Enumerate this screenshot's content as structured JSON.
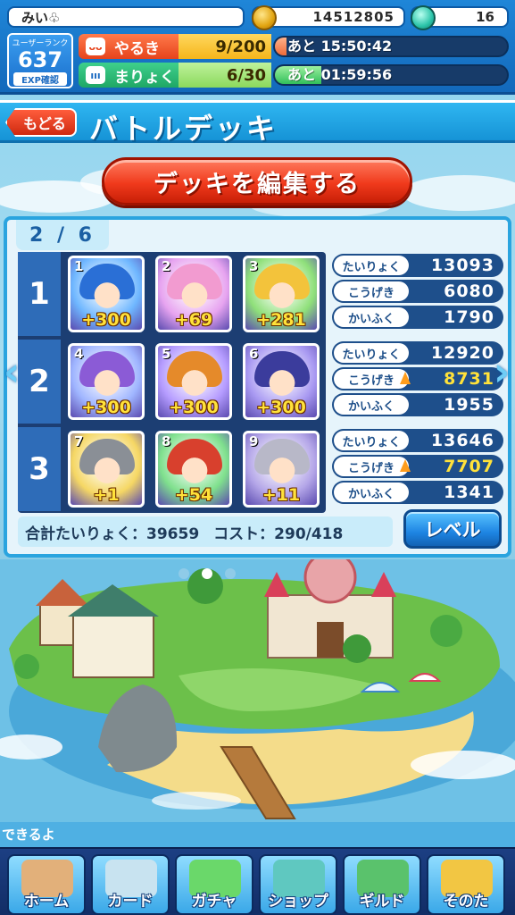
{
  "status": {
    "player_name": "みい♧",
    "coins": "14512805",
    "gems": "16",
    "rank_label": "ユーザーランク",
    "rank_value": "637",
    "exp_label": "EXP確認",
    "yaruki": {
      "label": "やるき",
      "count": "9/200",
      "timer": "あと 15:50:42",
      "fill": 0.05
    },
    "maryoku": {
      "label": "まりょく",
      "count": "6/30",
      "timer": "あと 01:59:56",
      "fill": 0.2
    }
  },
  "header": {
    "back_label": "もどる",
    "title": "バトルデッキ"
  },
  "edit_button_label": "デッキを編集する",
  "deck": {
    "page": "2 / 6",
    "rows": [
      {
        "num": "1",
        "cards": [
          {
            "slot": "1",
            "plus": "+300",
            "bg": "#6fb7ff",
            "hair": "#2a6fd6"
          },
          {
            "slot": "2",
            "plus": "+69",
            "bg": "#e7a4f0",
            "hair": "#f29bd0"
          },
          {
            "slot": "3",
            "plus": "+281",
            "bg": "#8fe07a",
            "hair": "#f3c33b"
          }
        ],
        "stats": [
          {
            "label": "たいりょく",
            "value": "13093",
            "boost": false
          },
          {
            "label": "こうげき",
            "value": "6080",
            "boost": false
          },
          {
            "label": "かいふく",
            "value": "1790",
            "boost": false
          }
        ]
      },
      {
        "num": "2",
        "cards": [
          {
            "slot": "4",
            "plus": "+300",
            "bg": "#9fb5ff",
            "hair": "#8b5bd6"
          },
          {
            "slot": "5",
            "plus": "+300",
            "bg": "#b59cff",
            "hair": "#e58a2a"
          },
          {
            "slot": "6",
            "plus": "+300",
            "bg": "#a99af2",
            "hair": "#3b3c9c"
          }
        ],
        "stats": [
          {
            "label": "たいりょく",
            "value": "12920",
            "boost": false
          },
          {
            "label": "こうげき",
            "value": "8731",
            "boost": true
          },
          {
            "label": "かいふく",
            "value": "1955",
            "boost": false
          }
        ]
      },
      {
        "num": "3",
        "cards": [
          {
            "slot": "7",
            "plus": "+1",
            "bg": "#f5d764",
            "hair": "#8a8f96"
          },
          {
            "slot": "8",
            "plus": "+54",
            "bg": "#7fe08d",
            "hair": "#d8402d"
          },
          {
            "slot": "9",
            "plus": "+11",
            "bg": "#b4a6e8",
            "hair": "#b8b8c8"
          }
        ],
        "stats": [
          {
            "label": "たいりょく",
            "value": "13646",
            "boost": false
          },
          {
            "label": "こうげき",
            "value": "7707",
            "boost": true
          },
          {
            "label": "かいふく",
            "value": "1341",
            "boost": false
          }
        ]
      }
    ],
    "total_hp": "合計たいりょく：39659",
    "cost": "コスト：290/418",
    "level_button": "レベル"
  },
  "ticker_text": "できるよ",
  "nav": [
    {
      "label": "ホーム",
      "icon": "home-icon",
      "color": "#e2b07a"
    },
    {
      "label": "カード",
      "icon": "card-icon",
      "color": "#c8e3f0"
    },
    {
      "label": "ガチャ",
      "icon": "gacha-icon",
      "color": "#6ad86a"
    },
    {
      "label": "ショップ",
      "icon": "shop-icon",
      "color": "#5fc8c0"
    },
    {
      "label": "ギルド",
      "icon": "guild-icon",
      "color": "#5ac26c"
    },
    {
      "label": "そのた",
      "icon": "other-icon",
      "color": "#f2c643"
    }
  ]
}
